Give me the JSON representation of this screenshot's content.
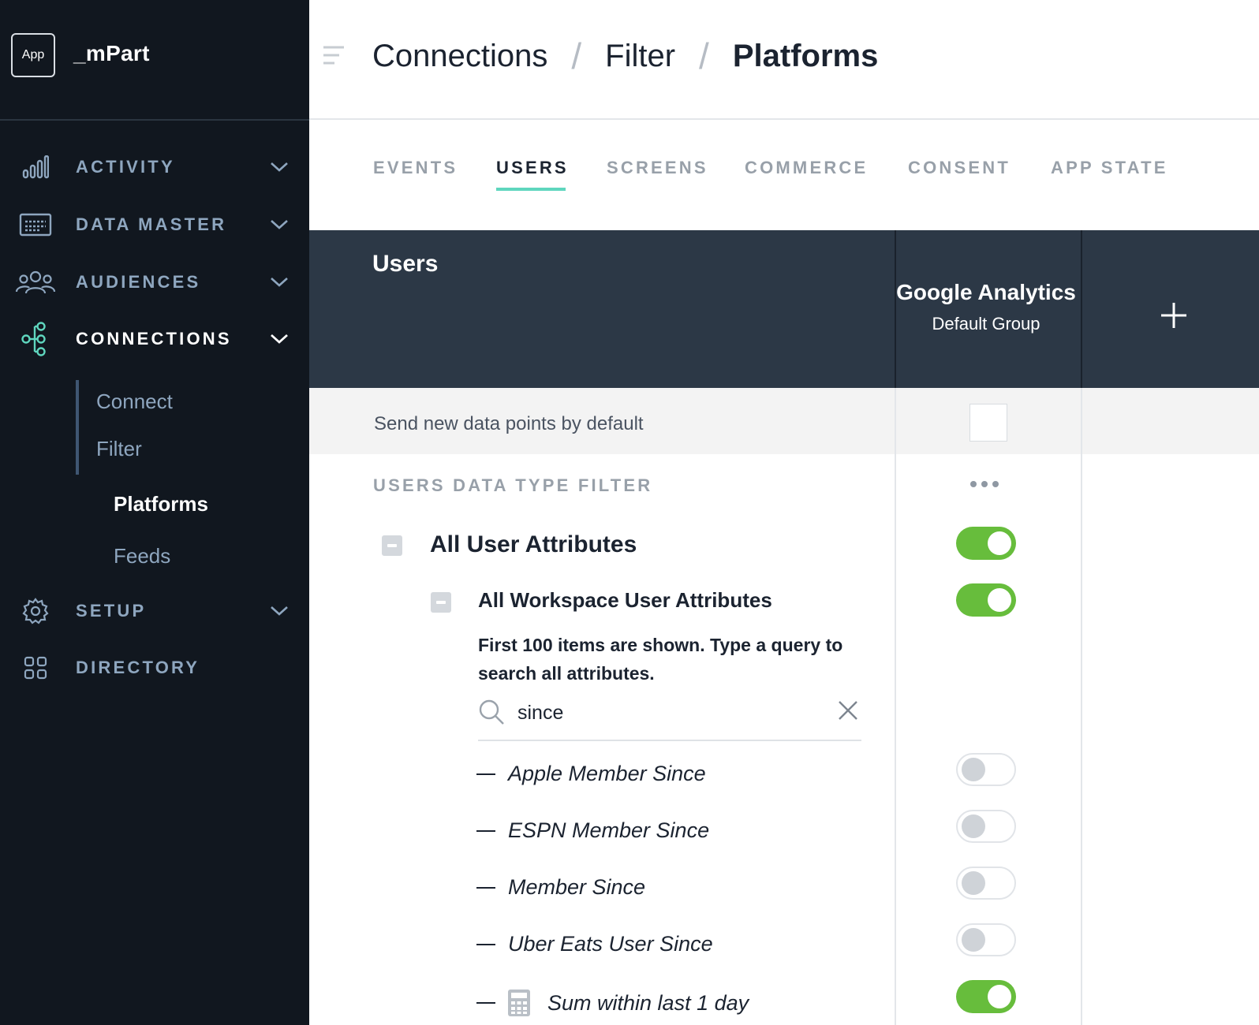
{
  "brand": {
    "app_badge": "App",
    "name": "_mPart"
  },
  "sidebar": {
    "items": [
      {
        "label": "ACTIVITY",
        "icon": "bar-chart-icon"
      },
      {
        "label": "DATA MASTER",
        "icon": "data-master-icon"
      },
      {
        "label": "AUDIENCES",
        "icon": "people-icon"
      },
      {
        "label": "CONNECTIONS",
        "icon": "connections-icon",
        "active": true
      },
      {
        "label": "SETUP",
        "icon": "gear-icon"
      },
      {
        "label": "DIRECTORY",
        "icon": "grid-icon"
      }
    ],
    "connections_sub": [
      "Connect",
      "Filter"
    ],
    "filter_sub": [
      "Platforms",
      "Feeds"
    ]
  },
  "header": {
    "breadcrumb": [
      "Connections",
      "Filter",
      "Platforms"
    ],
    "separator": "/"
  },
  "tabs": [
    "EVENTS",
    "USERS",
    "SCREENS",
    "COMMERCE",
    "CONSENT",
    "APP STATE"
  ],
  "active_tab": "USERS",
  "table": {
    "section_title": "Users",
    "column": {
      "title": "Google Analytics",
      "subtitle": "Default Group"
    },
    "add_column_icon": "plus-icon",
    "default_row_label": "Send new data points by default",
    "default_checked": false,
    "filter_heading": "USERS DATA TYPE FILTER",
    "more_icon": "more-dots-icon"
  },
  "attributes": {
    "all_label": "All User Attributes",
    "all_enabled": true,
    "workspace_label": "All Workspace User Attributes",
    "workspace_enabled": true,
    "note": "First 100 items are shown. Type a query to search all attributes.",
    "search_value": "since",
    "results": [
      {
        "label": "Apple Member Since",
        "enabled": false
      },
      {
        "label": "ESPN Member Since",
        "enabled": false
      },
      {
        "label": "Member Since",
        "enabled": false
      },
      {
        "label": "Uber Eats User Since",
        "enabled": false
      },
      {
        "label": "Sum within last 1 day",
        "enabled": true,
        "icon": "calculator-icon"
      }
    ]
  },
  "colors": {
    "accent": "#5fd6be",
    "toggle_on": "#67bd3c",
    "sidebar_bg": "#11171f",
    "table_header_bg": "#2c3846"
  }
}
